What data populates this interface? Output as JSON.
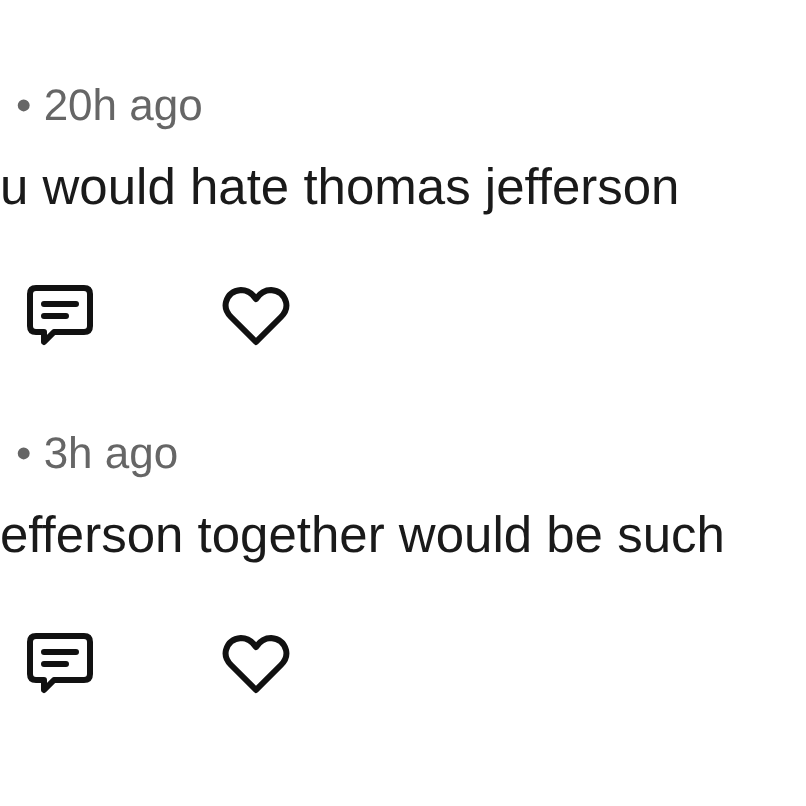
{
  "comments": [
    {
      "meta": "• 20h ago",
      "body": "u would hate thomas jefferson"
    },
    {
      "meta": "• 3h ago",
      "body": "efferson together would be such"
    }
  ]
}
